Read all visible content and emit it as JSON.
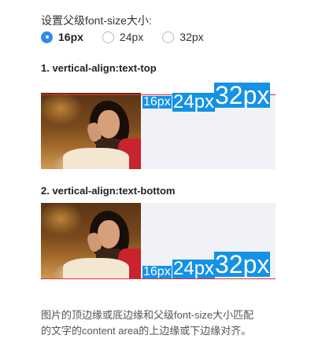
{
  "title": "设置父级font-size大小:",
  "radios": [
    {
      "label": "16px",
      "selected": true
    },
    {
      "label": "24px",
      "selected": false
    },
    {
      "label": "32px",
      "selected": false
    }
  ],
  "sections": [
    {
      "heading": "1. vertical-align:text-top",
      "badges": [
        "16px",
        "24px",
        "32px"
      ]
    },
    {
      "heading": "2. vertical-align:text-bottom",
      "badges": [
        "16px",
        "24px",
        "32px"
      ]
    }
  ],
  "description": {
    "line1": "图片的顶边缘或底边缘和父级font-size大小匹配",
    "line2": "的文字的content area的上边缘或下边缘对齐。"
  },
  "colors": {
    "accent": "#2a8cf0",
    "badge": "#1492e6",
    "line": "#e0323a",
    "box": "#f0f2f8"
  }
}
